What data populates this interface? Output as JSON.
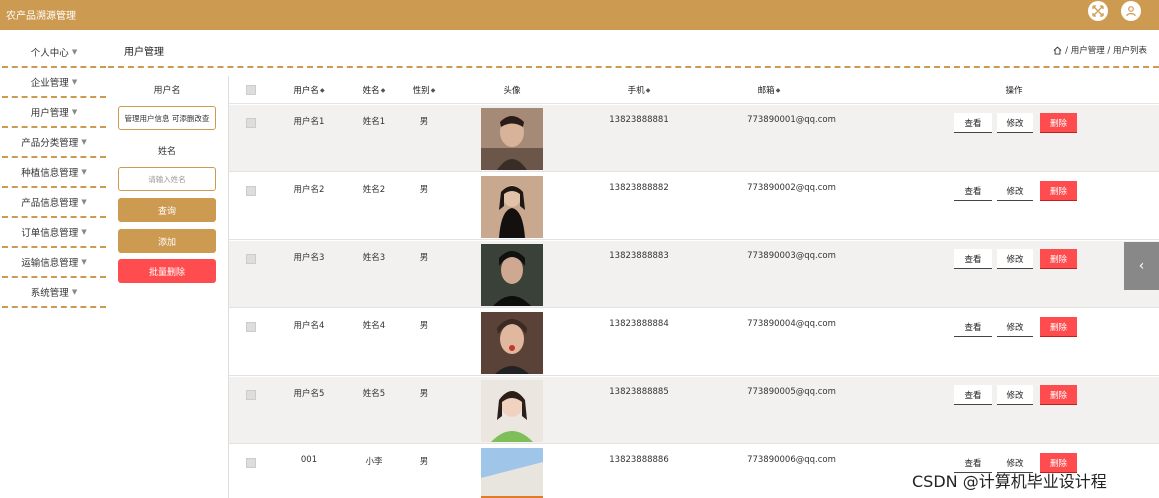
{
  "app": {
    "title": "农产品溯源管理"
  },
  "topbar": {
    "icons": [
      "expand-icon",
      "user-icon"
    ]
  },
  "sidebar": {
    "items": [
      {
        "label": "个人中心"
      },
      {
        "label": "企业管理"
      },
      {
        "label": "用户管理"
      },
      {
        "label": "产品分类管理"
      },
      {
        "label": "种植信息管理"
      },
      {
        "label": "产品信息管理"
      },
      {
        "label": "订单信息管理"
      },
      {
        "label": "运输信息管理"
      },
      {
        "label": "系统管理"
      }
    ]
  },
  "header": {
    "title": "用户管理",
    "breadcrumb": "/ 用户管理 / 用户列表"
  },
  "filters": {
    "username_label": "用户名",
    "username_value": "管理用户信息 可添删改查",
    "name_label": "姓名",
    "name_placeholder": "请输入姓名",
    "search_button": "查询",
    "add_button": "添加",
    "batch_delete_button": "批量删除"
  },
  "table": {
    "columns": {
      "username": "用户名",
      "name": "姓名",
      "gender": "性别",
      "avatar": "头像",
      "phone": "手机",
      "email": "邮箱",
      "actions": "操作"
    },
    "actions": {
      "view": "查看",
      "edit": "修改",
      "delete": "删除"
    },
    "rows": [
      {
        "username": "用户名1",
        "name": "姓名1",
        "gender": "男",
        "phone": "13823888881",
        "email": "773890001@qq.com"
      },
      {
        "username": "用户名2",
        "name": "姓名2",
        "gender": "男",
        "phone": "13823888882",
        "email": "773890002@qq.com"
      },
      {
        "username": "用户名3",
        "name": "姓名3",
        "gender": "男",
        "phone": "13823888883",
        "email": "773890003@qq.com"
      },
      {
        "username": "用户名4",
        "name": "姓名4",
        "gender": "男",
        "phone": "13823888884",
        "email": "773890004@qq.com"
      },
      {
        "username": "用户名5",
        "name": "姓名5",
        "gender": "男",
        "phone": "13823888885",
        "email": "773890005@qq.com"
      },
      {
        "username": "001",
        "name": "小李",
        "gender": "男",
        "phone": "13823888886",
        "email": "773890006@qq.com"
      }
    ]
  },
  "watermark": "CSDN @计算机毕业设计程",
  "colors": {
    "brand": "#cd9a52",
    "danger": "#ff4d4f"
  }
}
